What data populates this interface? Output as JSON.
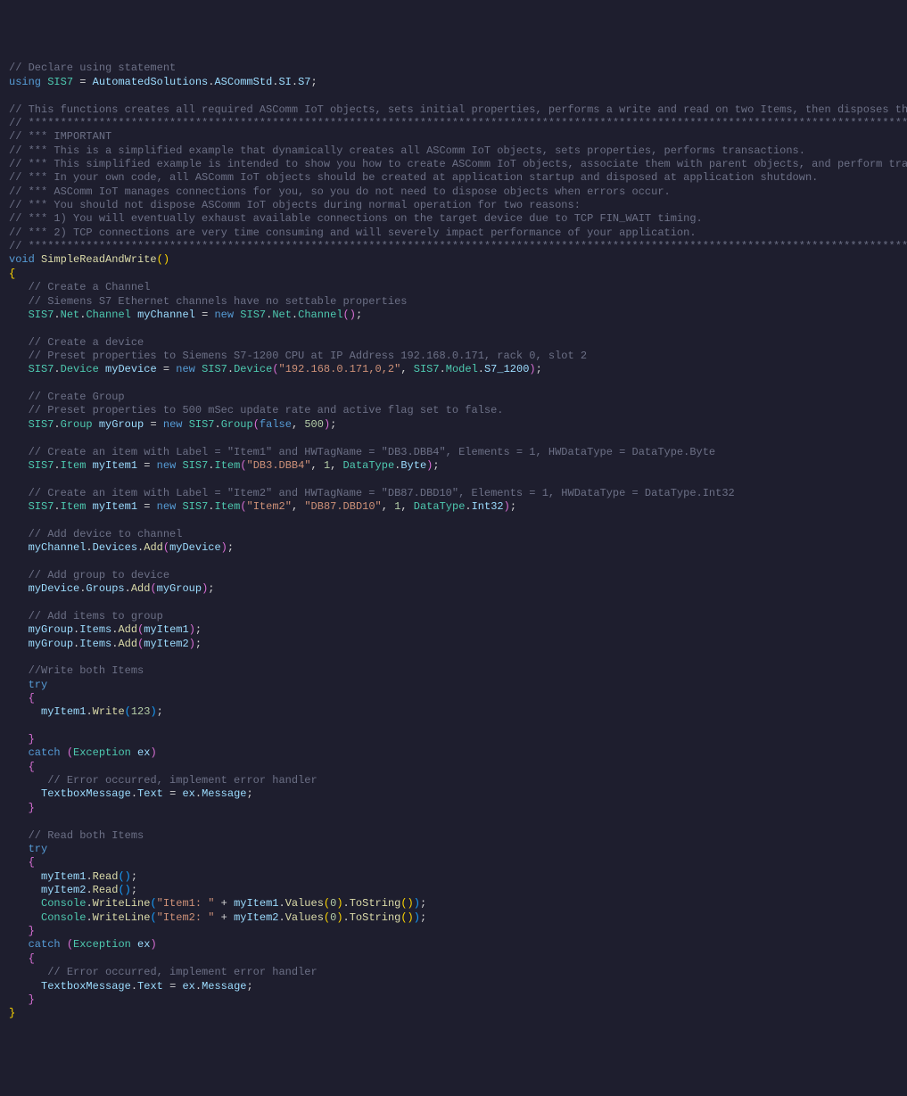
{
  "c": {
    "declare": "// Declare using statement",
    "using": "using",
    "alias": "SIS7",
    "ns": "AutomatedSolutions",
    "ascomm": "ASCommStd",
    "si": "SI",
    "s7": "S7",
    "funcCmt": "// This functions creates all required ASComm IoT objects, sets initial properties, performs a write and read on two Items, then disposes the ASComm IoT objects",
    "stars": "// ***********************************************************************************************************************************************************************",
    "important": "// *** IMPORTANT",
    "l1": "// *** This is a simplified example that dynamically creates all ASComm IoT objects, sets properties, performs transactions.",
    "l2": "// *** This simplified example is intended to show you how to create ASComm IoT objects, associate them with parent objects, and perform transactions only",
    "l3": "// *** In your own code, all ASComm IoT objects should be created at application startup and disposed at application shutdown.",
    "l4": "// *** ASComm IoT manages connections for you, so you do not need to dispose objects when errors occur.",
    "l5": "// *** You should not dispose ASComm IoT objects during normal operation for two reasons:",
    "l6": "// *** 1) You will eventually exhaust available connections on the target device due to TCP FIN_WAIT timing.",
    "l7": "// *** 2) TCP connections are very time consuming and will severely impact performance of your application.",
    "void": "void",
    "fnName": "SimpleReadAndWrite",
    "createChan": "// Create a Channel",
    "chanNote": "// Siemens S7 Ethernet channels have no settable properties",
    "Net": "Net",
    "Channel": "Channel",
    "myChannel": "myChannel",
    "new": "new",
    "createDev": "// Create a device",
    "devNote": "// Preset properties to Siemens S7-1200 CPU at IP Address 192.168.0.171, rack 0, slot 2",
    "Device": "Device",
    "myDevice": "myDevice",
    "ip": "\"192.168.0.171,0,2\"",
    "Model": "Model",
    "S7_1200": "S7_1200",
    "createGrp": "// Create Group",
    "grpNote": "// Preset properties to 500 mSec update rate and active flag set to false.",
    "Group": "Group",
    "myGroup": "myGroup",
    "false": "false",
    "n500": "500",
    "item1Cmt": "// Create an item with Label = \"Item1\" and HWTagName = \"DB3.DBB4\", Elements = 1, HWDataType = DataType.Byte",
    "Item": "Item",
    "myItem1": "myItem1",
    "db3": "\"DB3.DBB4\"",
    "n1": "1",
    "DataType": "DataType",
    "Byte": "Byte",
    "item2Cmt": "// Create an item with Label = \"Item2\" and HWTagName = \"DB87.DBD10\", Elements = 1, HWDataType = DataType.Int32",
    "item2s": "\"Item2\"",
    "db87": "\"DB87.DBD10\"",
    "Int32": "Int32",
    "addDevCmt": "// Add device to channel",
    "Devices": "Devices",
    "Add": "Add",
    "addGrpCmt": "// Add group to device",
    "Groups": "Groups",
    "addItemsCmt": "// Add items to group",
    "Items": "Items",
    "myItem2": "myItem2",
    "writeCmt": "//Write both Items",
    "try": "try",
    "Write": "Write",
    "n123": "123",
    "catch": "catch",
    "Exception": "Exception",
    "ex": "ex",
    "errCmt": "// Error occurred, implement error handler",
    "TextboxMessage": "TextboxMessage",
    "Text": "Text",
    "Message": "Message",
    "readCmt": "// Read both Items",
    "Read": "Read",
    "Console": "Console",
    "WriteLine": "WriteLine",
    "it1s": "\"Item1: \"",
    "it2s": "\"Item2: \"",
    "Values": "Values",
    "n0": "0",
    "ToString": "ToString"
  }
}
